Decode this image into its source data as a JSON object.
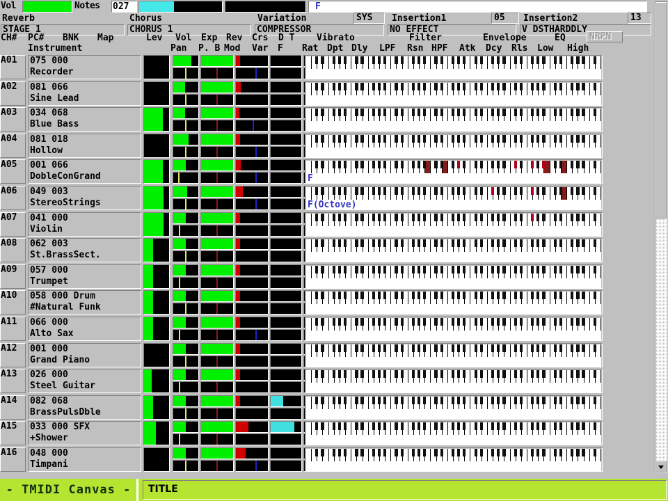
{
  "app": {
    "name": "- TMIDI Canvas -",
    "title_label": "TITLE"
  },
  "top_meters": {
    "vol_label": "Vol",
    "vol_percent": 100,
    "notes_label": "Notes",
    "notes_value": "027",
    "meter_a_percent": 42,
    "meter_b_percent": 0,
    "chord_display": "F",
    "colors": {
      "vol_green": "#00f000",
      "meter_cyan": "#44e8e8",
      "chord_blue": "#3030c8"
    }
  },
  "effects": {
    "reverb": {
      "label": "Reverb",
      "value": "STAGE 1"
    },
    "chorus": {
      "label": "Chorus",
      "value": "CHORUS 1"
    },
    "variation": {
      "label": "Variation",
      "mode": "SYS",
      "value": "COMPRESSOR"
    },
    "insertion1": {
      "label": "Insertion1",
      "num": "05",
      "value": "NO EFFECT"
    },
    "insertion2": {
      "label": "Insertion2",
      "num": "13",
      "value": "V DSTHARDDLY"
    }
  },
  "columns": {
    "group_labels": [
      "CH#",
      "PC#",
      "BNK",
      "Map",
      "Lev",
      "Vol",
      "Exp",
      "Rev",
      "Crs",
      "D",
      "T",
      "Vibrato",
      "Filter",
      "Envelope",
      "EQ"
    ],
    "row1": [
      "CH#",
      "PC#",
      "BNK",
      "Map",
      "Lev",
      "Vol",
      "Exp",
      "Rev",
      "Crs",
      "D T",
      "Vibrato",
      "Filter",
      "Envelope",
      "EQ"
    ],
    "row2_left": "Instrument",
    "row2": [
      "Pan",
      "P. B",
      "Mod",
      "Var",
      "F",
      "Rat",
      "Dpt",
      "Dly",
      "LPF",
      "Rsn",
      "HPF",
      "Atk",
      "Dcy",
      "Rls",
      "Low",
      "High"
    ],
    "nrpn_label": "NRPN",
    "nrpn_enabled": false
  },
  "channels": [
    {
      "ch": "A01",
      "pc": "075",
      "bnk": "000",
      "map": "",
      "inst": "Recorder",
      "lev": 0,
      "vol": 72,
      "exp": 100,
      "rev": 12,
      "crs": 0,
      "dt": 0,
      "t": 0,
      "pan": 50,
      "pb": 50,
      "mod": 62,
      "var": 0,
      "f": 0,
      "chord": "",
      "notes": []
    },
    {
      "ch": "A02",
      "pc": "081",
      "bnk": "066",
      "map": "",
      "inst": "Sine Lead",
      "lev": 0,
      "vol": 48,
      "exp": 100,
      "rev": 16,
      "crs": 0,
      "dt": 0,
      "t": 0,
      "pan": 50,
      "pb": 50,
      "mod": 0,
      "var": 0,
      "f": 0,
      "chord": "",
      "notes": []
    },
    {
      "ch": "A03",
      "pc": "034",
      "bnk": "068",
      "map": "",
      "inst": "Blue Bass",
      "lev": 74,
      "vol": 48,
      "exp": 100,
      "rev": 10,
      "crs": 0,
      "dt": 0,
      "t": 0,
      "pan": 50,
      "pb": 50,
      "mod": 55,
      "var": 0,
      "f": 0,
      "chord": "",
      "notes": []
    },
    {
      "ch": "A04",
      "pc": "081",
      "bnk": "018",
      "map": "",
      "inst": "Hollow",
      "lev": 0,
      "vol": 62,
      "exp": 100,
      "rev": 14,
      "crs": 0,
      "dt": 0,
      "t": 0,
      "pan": 50,
      "pb": 50,
      "mod": 62,
      "var": 0,
      "f": 0,
      "chord": "",
      "notes": []
    },
    {
      "ch": "A05",
      "pc": "001",
      "bnk": "066",
      "map": "",
      "inst": "DobleConGrand",
      "lev": 76,
      "vol": 50,
      "exp": 100,
      "rev": 15,
      "crs": 0,
      "dt": 0,
      "t": 0,
      "pan": 22,
      "pb": 50,
      "mod": 62,
      "var": 0,
      "f": 0,
      "chord": "F",
      "notes": [
        21,
        24,
        26,
        36,
        39,
        41,
        42,
        45
      ]
    },
    {
      "ch": "A06",
      "pc": "049",
      "bnk": "003",
      "map": "",
      "inst": "StereoStrings",
      "lev": 78,
      "vol": 55,
      "exp": 100,
      "rev": 22,
      "crs": 0,
      "dt": 0,
      "t": 0,
      "pan": 50,
      "pb": 50,
      "mod": 62,
      "var": 0,
      "f": 0,
      "chord": "F(Octove)",
      "notes": [
        32,
        39,
        45
      ]
    },
    {
      "ch": "A07",
      "pc": "041",
      "bnk": "000",
      "map": "",
      "inst": "Violin",
      "lev": 78,
      "vol": 50,
      "exp": 100,
      "rev": 12,
      "crs": 0,
      "dt": 0,
      "t": 0,
      "pan": 26,
      "pb": 50,
      "mod": 0,
      "var": 0,
      "f": 0,
      "chord": "",
      "notes": [
        39
      ]
    },
    {
      "ch": "A08",
      "pc": "062",
      "bnk": "003",
      "map": "",
      "inst": "St.BrassSect.",
      "lev": 36,
      "vol": 50,
      "exp": 100,
      "rev": 14,
      "crs": 0,
      "dt": 0,
      "t": 0,
      "pan": 50,
      "pb": 50,
      "mod": 0,
      "var": 0,
      "f": 0,
      "chord": "",
      "notes": []
    },
    {
      "ch": "A09",
      "pc": "057",
      "bnk": "000",
      "map": "",
      "inst": "Trumpet",
      "lev": 36,
      "vol": 50,
      "exp": 100,
      "rev": 14,
      "crs": 0,
      "dt": 0,
      "t": 0,
      "pan": 26,
      "pb": 50,
      "mod": 0,
      "var": 0,
      "f": 0,
      "chord": "",
      "notes": []
    },
    {
      "ch": "A10",
      "pc": "058",
      "bnk": "000",
      "map": "Drum",
      "inst": "#Natural Funk",
      "lev": 36,
      "vol": 50,
      "exp": 100,
      "rev": 14,
      "crs": 0,
      "dt": 0,
      "t": 0,
      "pan": 50,
      "pb": 50,
      "mod": 0,
      "var": 0,
      "f": 0,
      "chord": "",
      "notes": []
    },
    {
      "ch": "A11",
      "pc": "066",
      "bnk": "000",
      "map": "",
      "inst": "Alto Sax",
      "lev": 36,
      "vol": 50,
      "exp": 100,
      "rev": 14,
      "crs": 0,
      "dt": 0,
      "t": 0,
      "pan": 26,
      "pb": 50,
      "mod": 62,
      "var": 0,
      "f": 0,
      "chord": "",
      "notes": []
    },
    {
      "ch": "A12",
      "pc": "001",
      "bnk": "000",
      "map": "",
      "inst": "Grand Piano",
      "lev": 0,
      "vol": 50,
      "exp": 100,
      "rev": 14,
      "crs": 0,
      "dt": 0,
      "t": 0,
      "pan": 50,
      "pb": 50,
      "mod": 0,
      "var": 0,
      "f": 0,
      "chord": "",
      "notes": []
    },
    {
      "ch": "A13",
      "pc": "026",
      "bnk": "000",
      "map": "",
      "inst": "Steel Guitar",
      "lev": 30,
      "vol": 50,
      "exp": 100,
      "rev": 14,
      "crs": 0,
      "dt": 0,
      "t": 0,
      "pan": 26,
      "pb": 50,
      "mod": 0,
      "var": 0,
      "f": 0,
      "chord": "",
      "notes": []
    },
    {
      "ch": "A14",
      "pc": "082",
      "bnk": "068",
      "map": "",
      "inst": "BrassPulsDble",
      "lev": 36,
      "vol": 50,
      "exp": 100,
      "rev": 14,
      "crs": 42,
      "dt": 0,
      "t": 0,
      "pan": 50,
      "pb": 50,
      "mod": 0,
      "var": 0,
      "f": 0,
      "chord": "",
      "notes": []
    },
    {
      "ch": "A15",
      "pc": "033",
      "bnk": "000",
      "map": "SFX",
      "inst": "+Shower",
      "lev": 48,
      "vol": 50,
      "exp": 100,
      "rev": 40,
      "crs": 78,
      "dt": 0,
      "t": 0,
      "pan": 26,
      "pb": 50,
      "mod": 0,
      "var": 0,
      "f": 0,
      "chord": "",
      "notes": []
    },
    {
      "ch": "A16",
      "pc": "048",
      "bnk": "000",
      "map": "",
      "inst": "Timpani",
      "lev": 0,
      "vol": 50,
      "exp": 100,
      "rev": 30,
      "crs": 0,
      "dt": 0,
      "t": 0,
      "pan": 50,
      "pb": 50,
      "mod": 62,
      "var": 0,
      "f": 0,
      "chord": "",
      "notes": []
    }
  ],
  "scrollbar": {
    "thumb_percent": 48,
    "down_arrow": "chevron-down-icon"
  },
  "palette": {
    "bar_green": "#00f000",
    "bar_red": "#d00000",
    "bar_cyan": "#40e0e0",
    "bar_blue": "#2020d0",
    "bar_yellow": "#e8e870",
    "bar_darkred": "#8a1a1a",
    "cell_black": "#000000",
    "face": "#c0c0c0",
    "bottom_green": "#b5e530"
  }
}
